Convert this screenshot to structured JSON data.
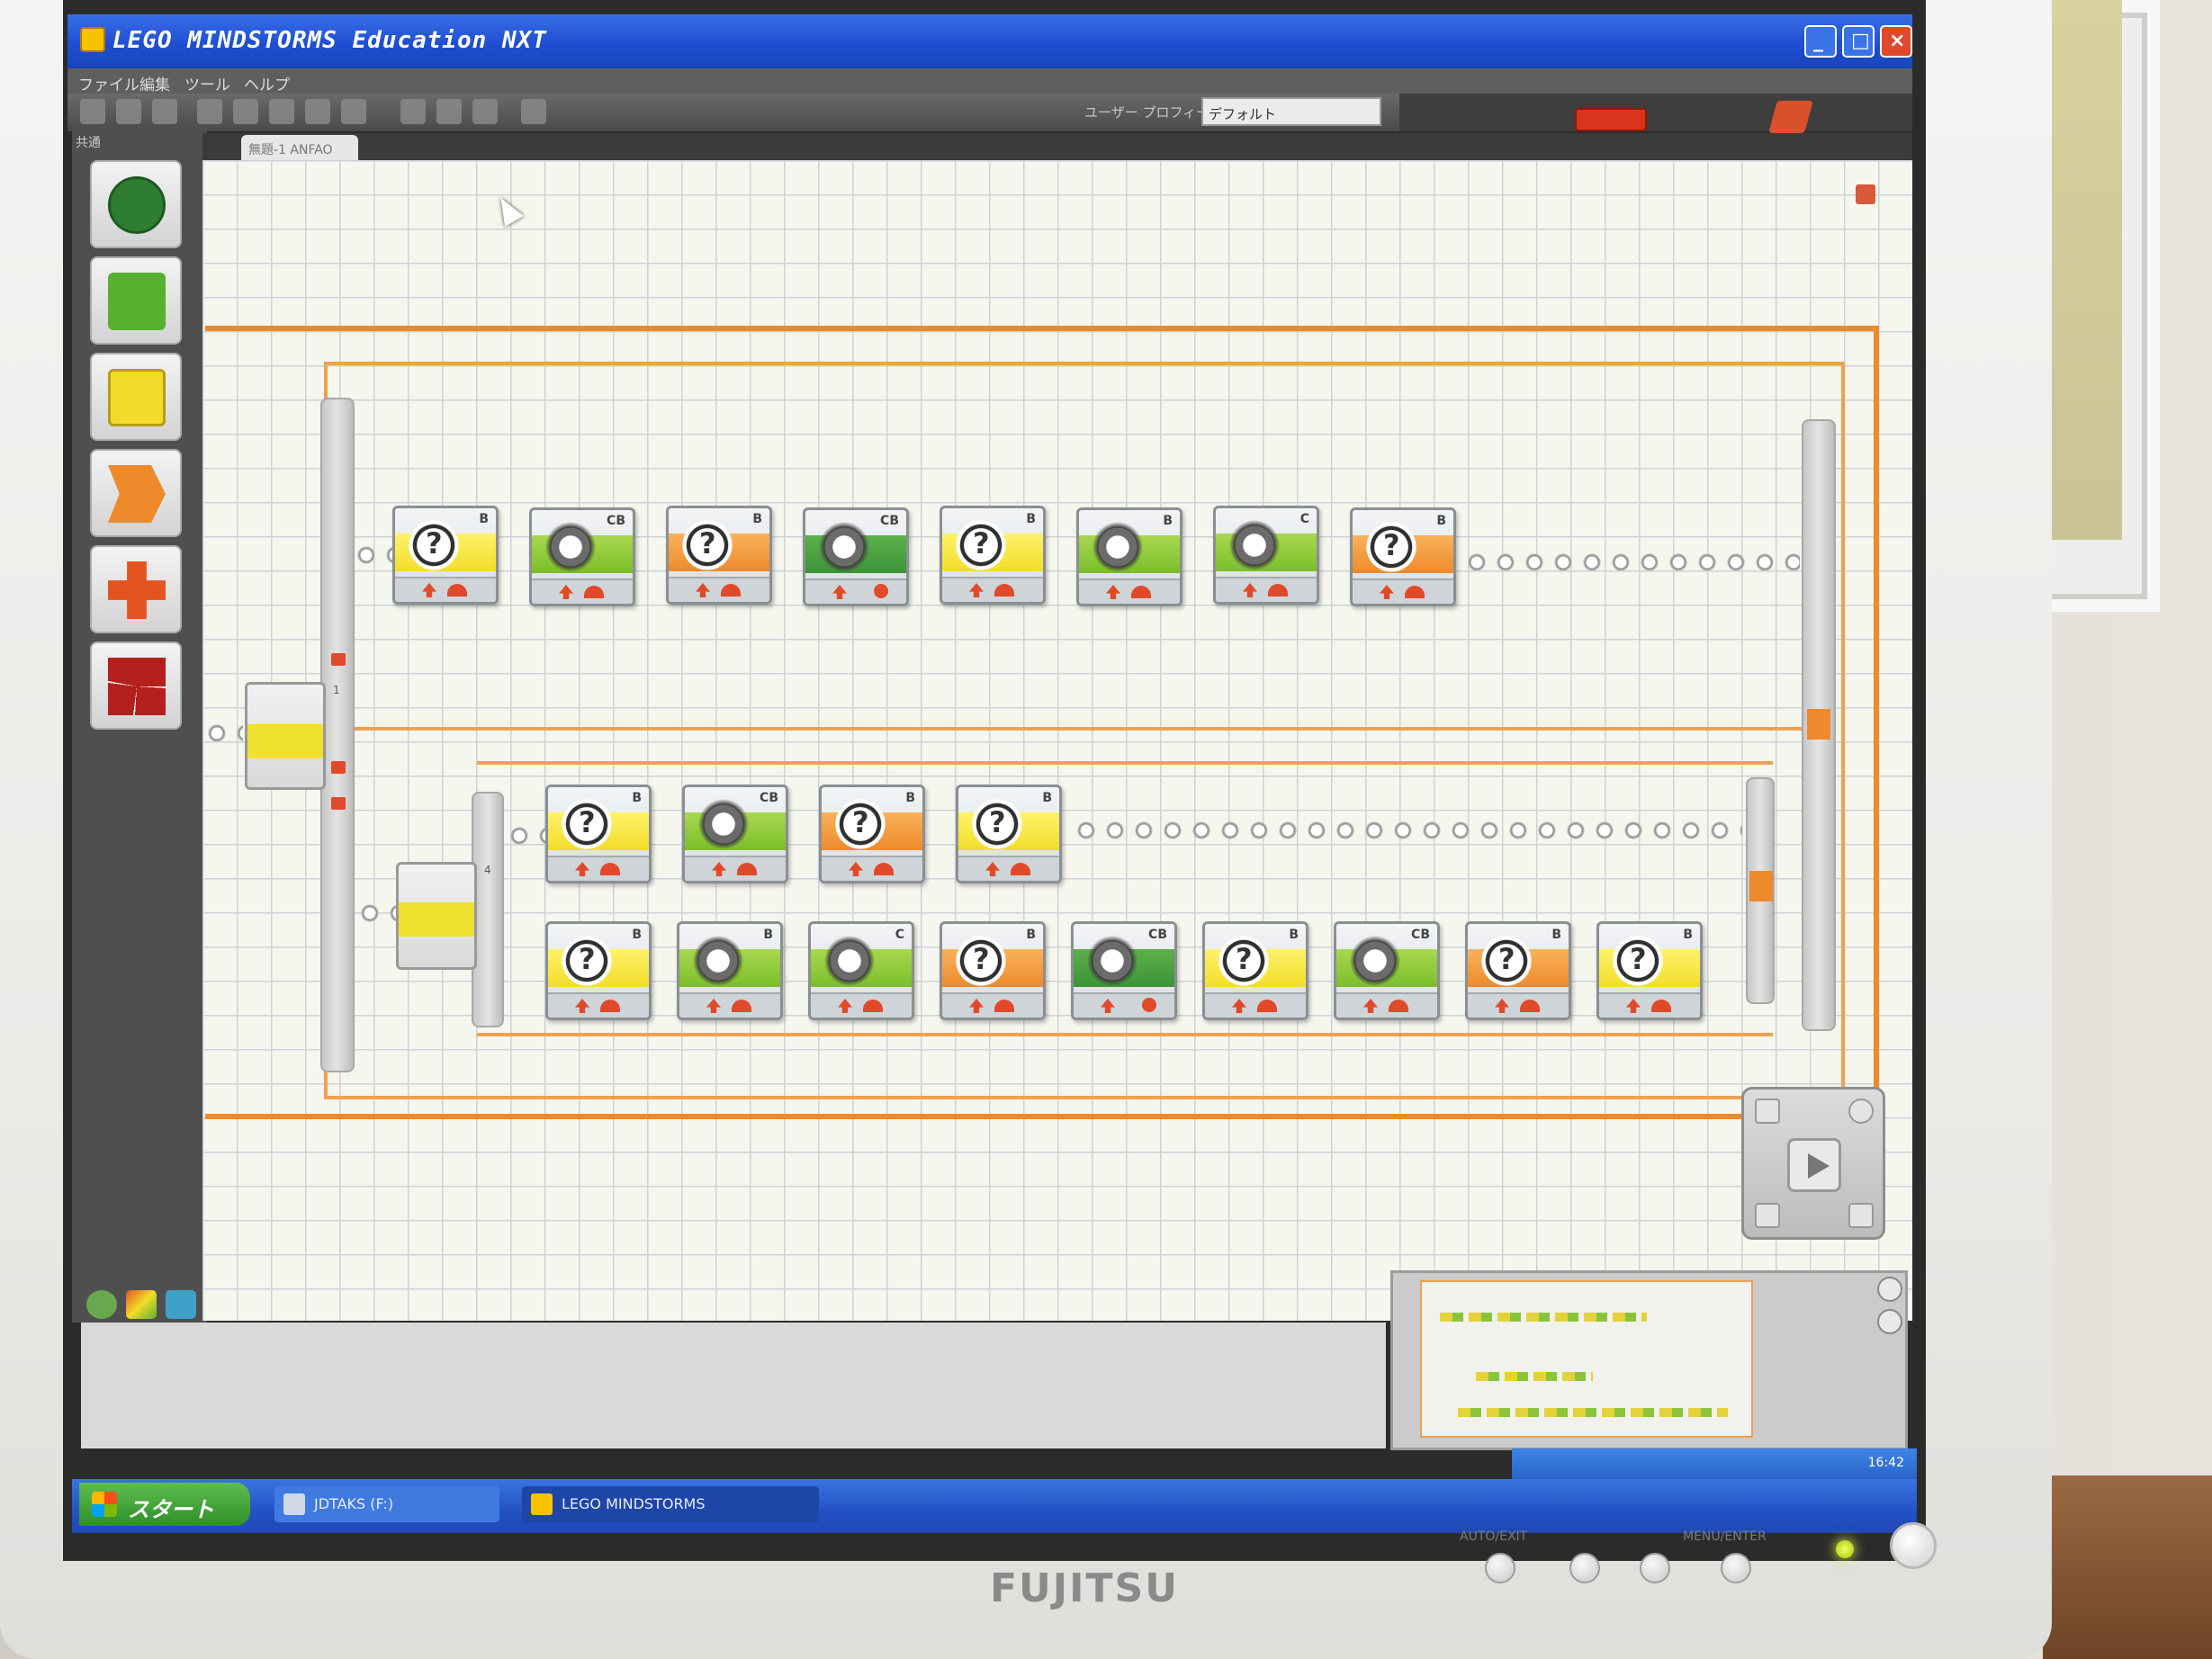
{
  "window": {
    "title": "LEGO MINDSTORMS Education NXT"
  },
  "menubar": {
    "items": [
      "ファイル",
      "編集",
      "ツール",
      "ヘルプ"
    ]
  },
  "toolbar": {
    "profile_label": "ユーザー プロフィール:",
    "profile_value": "デフォルト"
  },
  "palette": {
    "header": "共通",
    "tiles": [
      {
        "name": "move-block",
        "color": "#2e7d32"
      },
      {
        "name": "record-play-block",
        "color": "#58b030"
      },
      {
        "name": "sound-block",
        "color": "#f2dc2a"
      },
      {
        "name": "wait-block",
        "color": "#ee8a2c"
      },
      {
        "name": "loop-block",
        "color": "#e35420"
      },
      {
        "name": "switch-block",
        "color": "#b3201e"
      }
    ]
  },
  "editor": {
    "tab_label": "無題-1 ANFAO"
  },
  "program": {
    "row1": [
      {
        "type": "motor-rotation",
        "port": "B",
        "band": "yellow"
      },
      {
        "type": "move",
        "port": "CB",
        "band": "green"
      },
      {
        "type": "motor-rotation",
        "port": "B",
        "band": "orange"
      },
      {
        "type": "move",
        "port": "CB",
        "band": "greenstop"
      },
      {
        "type": "motor-rotation",
        "port": "B",
        "band": "yellow"
      },
      {
        "type": "motor",
        "port": "B",
        "band": "green"
      },
      {
        "type": "motor",
        "port": "C",
        "band": "green"
      },
      {
        "type": "motor-rotation",
        "port": "B",
        "band": "orange"
      }
    ],
    "row2": [
      {
        "type": "motor-rotation",
        "port": "B",
        "band": "yellow"
      },
      {
        "type": "move",
        "port": "CB",
        "band": "green"
      },
      {
        "type": "motor-rotation",
        "port": "B",
        "band": "orange"
      },
      {
        "type": "motor-rotation",
        "port": "B",
        "band": "yellow"
      }
    ],
    "row3": [
      {
        "type": "motor-rotation",
        "port": "B",
        "band": "yellow"
      },
      {
        "type": "motor",
        "port": "B",
        "band": "green"
      },
      {
        "type": "motor",
        "port": "C",
        "band": "green"
      },
      {
        "type": "motor-rotation",
        "port": "B",
        "band": "orange"
      },
      {
        "type": "move",
        "port": "CB",
        "band": "greenstop"
      },
      {
        "type": "motor-rotation",
        "port": "B",
        "band": "yellow"
      },
      {
        "type": "move",
        "port": "CB",
        "band": "green"
      },
      {
        "type": "motor-rotation",
        "port": "B",
        "band": "orange"
      },
      {
        "type": "motor-rotation",
        "port": "B",
        "band": "yellow"
      }
    ],
    "switch_main_cases": [
      "1"
    ],
    "switch_inner_cases": [
      "4"
    ]
  },
  "tray": {
    "time": "16:42"
  },
  "taskbar": {
    "start_label": "スタート",
    "items": [
      "JDTAKS (F:)",
      "LEGO MINDSTORMS"
    ]
  },
  "monitor": {
    "brand": "FUJITSU",
    "labels": {
      "auto_exit": "AUTO/EXIT",
      "menu_enter": "MENU/ENTER"
    }
  },
  "colors": {
    "beam": "#ee8a2c",
    "titlebar": "#1f4fd0",
    "canvas": "#f5f6ee"
  }
}
